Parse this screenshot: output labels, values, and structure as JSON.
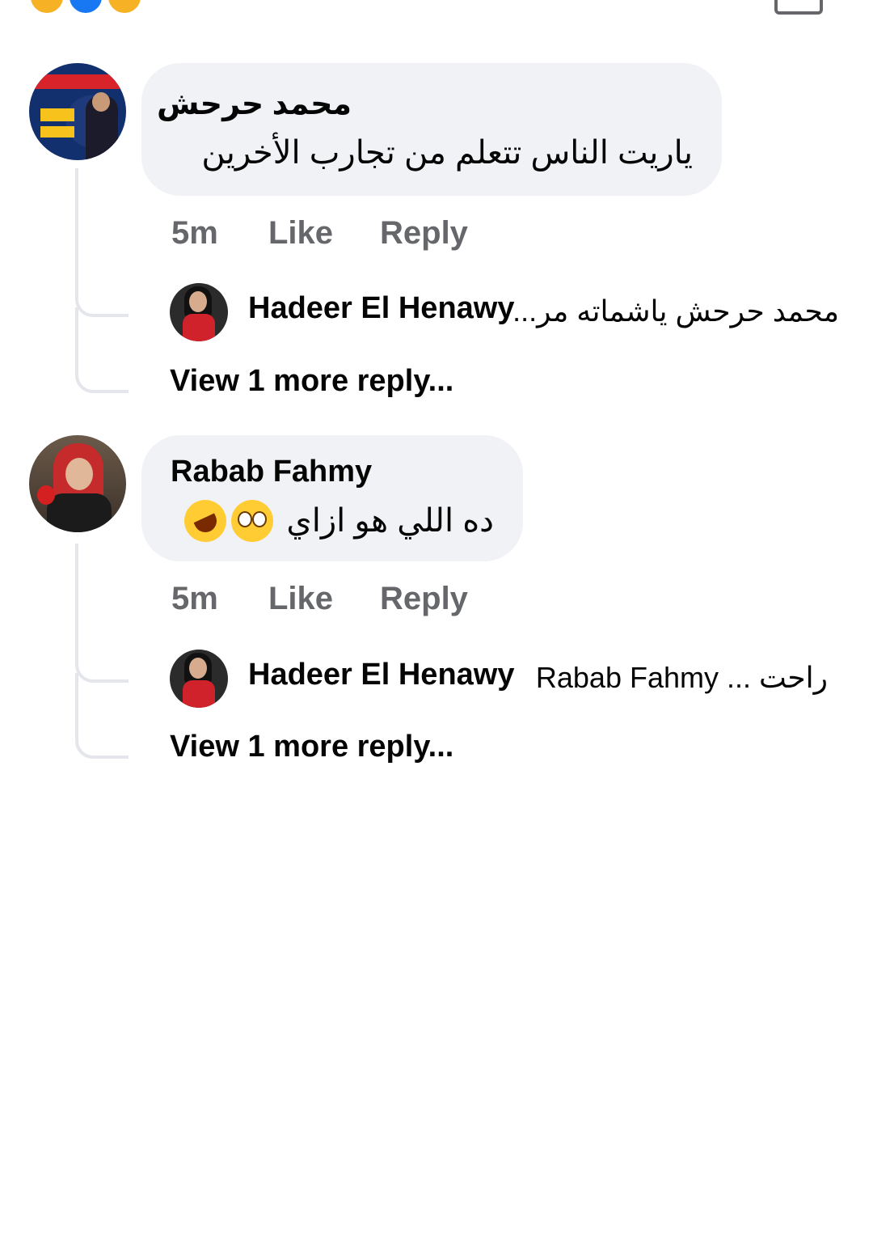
{
  "top": {
    "reaction_icons": [
      "haha-reaction-icon",
      "like-reaction-icon",
      "wow-reaction-icon"
    ],
    "like_icon": "like-thumb-icon"
  },
  "comments": [
    {
      "author": "محمد حرحش",
      "text": "ياريت الناس تتعلم من تجارب الأخرين",
      "time": "5m",
      "like_label": "Like",
      "reply_label": "Reply",
      "reply_preview": {
        "author": "Hadeer El Henawy",
        "snippet": "محمد حرحش ياشماته مر..."
      },
      "view_more": "View 1 more reply..."
    },
    {
      "author": "Rabab Fahmy",
      "text": "ده اللي هو ازاي",
      "emojis": [
        "flushed-face-emoji",
        "rolling-on-floor-laughing-emoji"
      ],
      "time": "5m",
      "like_label": "Like",
      "reply_label": "Reply",
      "reply_preview": {
        "author": "Hadeer El Henawy",
        "snippet": "Rabab Fahmy ... راحت"
      },
      "view_more": "View 1 more reply..."
    }
  ]
}
